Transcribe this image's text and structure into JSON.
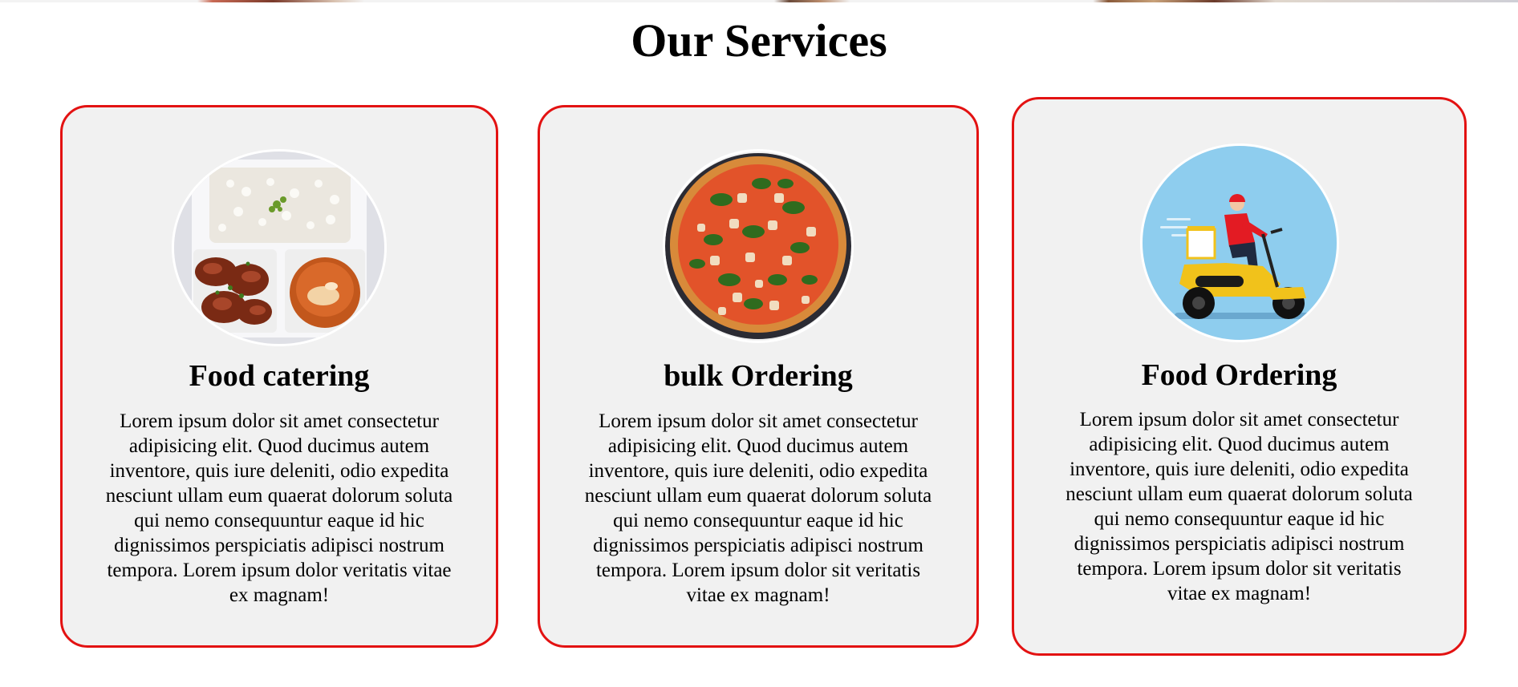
{
  "section": {
    "title": "Our Services"
  },
  "cards": [
    {
      "title": "Food catering",
      "text": "Lorem ipsum dolor sit amet consectetur adipisicing elit. Quod ducimus autem inventore, quis iure deleniti, odio expedita nesciunt ullam eum quaerat dolorum soluta qui nemo consequuntur eaque id hic dignissimos perspiciatis adipisci nostrum tempora. Lorem ipsum dolor veritatis vitae ex magnam!",
      "image_icon": "catering-thali-icon"
    },
    {
      "title": "bulk Ordering",
      "text": "Lorem ipsum dolor sit amet consectetur adipisicing elit. Quod ducimus autem inventore, quis iure deleniti, odio expedita nesciunt ullam eum quaerat dolorum soluta qui nemo consequuntur eaque id hic dignissimos perspiciatis adipisci nostrum tempora. Lorem ipsum dolor sit veritatis vitae ex magnam!",
      "image_icon": "pizza-icon"
    },
    {
      "title": "Food Ordering",
      "text": "Lorem ipsum dolor sit amet consectetur adipisicing elit. Quod ducimus autem inventore, quis iure deleniti, odio expedita nesciunt ullam eum quaerat dolorum soluta qui nemo consequuntur eaque id hic dignissimos perspiciatis adipisci nostrum tempora. Lorem ipsum dolor sit veritatis vitae ex magnam!",
      "image_icon": "delivery-scooter-icon"
    }
  ],
  "colors": {
    "card_border": "#e31212",
    "card_background": "#f1f1f1",
    "delivery_sky": "#8ecdee"
  }
}
